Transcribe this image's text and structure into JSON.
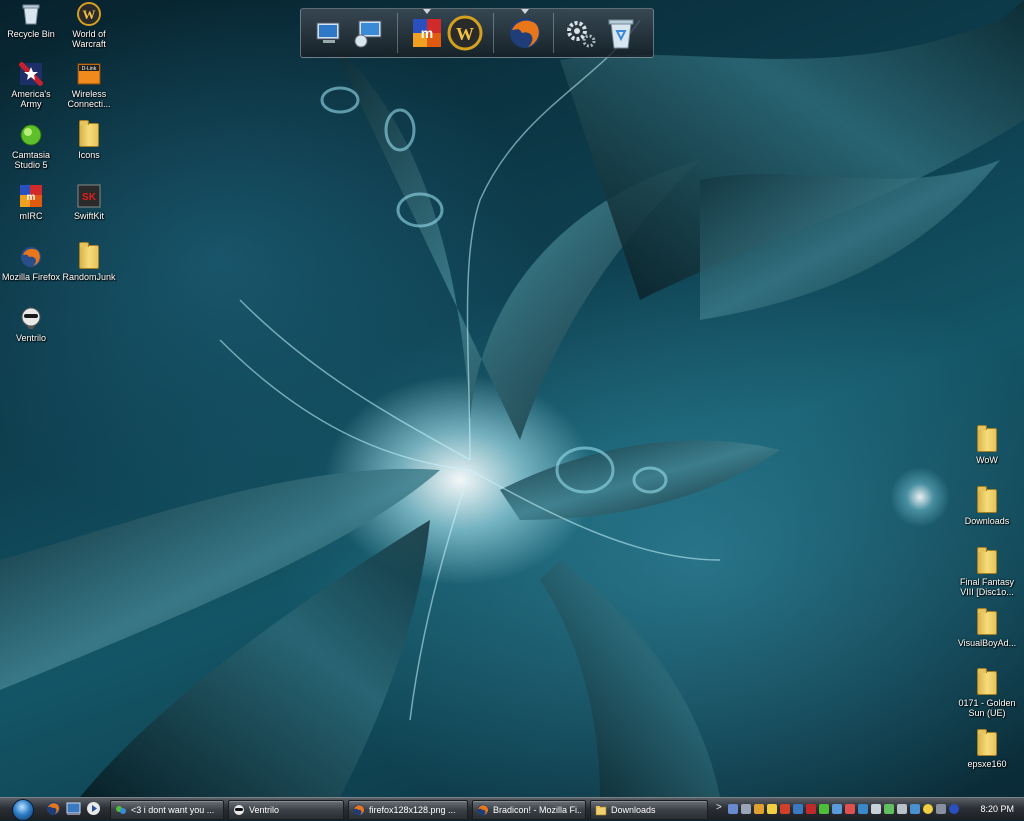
{
  "desktop": {
    "left_icons": [
      {
        "label": "Recycle Bin",
        "icon": "recycle-bin-icon"
      },
      {
        "label": "World of\nWarcraft",
        "icon": "world-of-warcraft-icon"
      },
      {
        "label": "America's\nArmy",
        "icon": "americas-army-icon"
      },
      {
        "label": "Wireless\nConnecti...",
        "icon": "dlink-wireless-icon"
      },
      {
        "label": "Camtasia\nStudio 5",
        "icon": "camtasia-icon"
      },
      {
        "label": "Icons",
        "icon": "folder-icon"
      },
      {
        "label": "mIRC",
        "icon": "mirc-icon"
      },
      {
        "label": "SwiftKit",
        "icon": "swiftkit-icon"
      },
      {
        "label": "Mozilla Firefox",
        "icon": "firefox-icon"
      },
      {
        "label": "RandomJunk",
        "icon": "folder-icon"
      },
      {
        "label": "Ventrilo",
        "icon": "ventrilo-icon"
      }
    ],
    "right_icons": [
      {
        "label": "WoW",
        "icon": "folder-icon"
      },
      {
        "label": "Downloads",
        "icon": "folder-icon"
      },
      {
        "label": "Final Fantasy\nVIII [Disc1o...",
        "icon": "folder-icon"
      },
      {
        "label": "VisualBoyAd...",
        "icon": "folder-icon"
      },
      {
        "label": "0171 - Golden\nSun (UE)",
        "icon": "folder-icon"
      },
      {
        "label": "epsxe160",
        "icon": "folder-icon"
      }
    ]
  },
  "dock": {
    "items": [
      "my-computer-icon",
      "network-icon",
      "mirc-icon",
      "world-of-warcraft-icon",
      "firefox-icon",
      "settings-gears-icon",
      "recycle-bin-icon"
    ]
  },
  "taskbar": {
    "start_icon": "windows-orb-icon",
    "quick_launch": [
      "firefox-icon",
      "show-desktop-icon",
      "media-player-icon"
    ],
    "tasks": [
      {
        "label": "<3 i dont want you ...",
        "icon": "chat-icon"
      },
      {
        "label": "Ventrilo",
        "icon": "ventrilo-icon"
      },
      {
        "label": "firefox128x128.png ...",
        "icon": "firefox-icon"
      },
      {
        "label": "Bradicon! - Mozilla Fi...",
        "icon": "firefox-icon"
      },
      {
        "label": "Downloads",
        "icon": "folder-icon"
      }
    ],
    "tray_expand": ">",
    "tray_icons": [
      "shield-icon",
      "speaker-icon",
      "user-icon",
      "warning-icon",
      "mirc-icon",
      "network-icon",
      "antivirus-icon",
      "graph-icon",
      "monitor-icon",
      "sync-icon",
      "window-icon",
      "volume-icon",
      "signal-icon",
      "battery-icon",
      "chat-icon",
      "smiley-icon",
      "gear-icon",
      "globe-icon"
    ],
    "clock": "8:20 PM"
  },
  "colors": {
    "wallpaper_base": "#0e4050",
    "folder": "#f6dc7a",
    "taskbar": "#2c3036"
  }
}
